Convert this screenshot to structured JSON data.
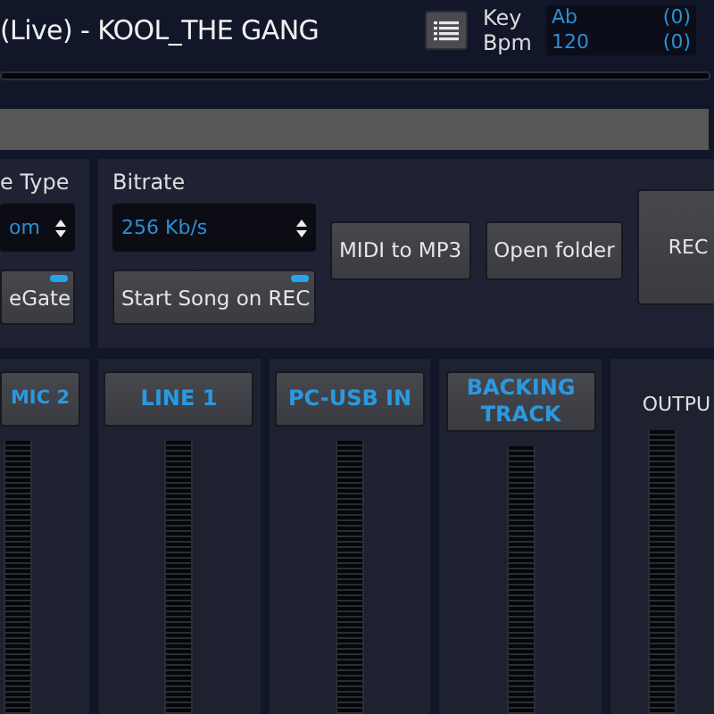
{
  "title": "(Live) - KOOL_THE GANG",
  "key": {
    "label": "Key",
    "value": "Ab",
    "offset": "(0)"
  },
  "bpm": {
    "label": "Bpm",
    "value": "120",
    "offset": "(0)"
  },
  "left_panel": {
    "label": "e Type",
    "select": "om",
    "toggle": {
      "label": "eGate",
      "on": true
    }
  },
  "bitrate": {
    "label": "Bitrate",
    "select": "256 Kb/s",
    "toggle": {
      "label": "Start Song on REC",
      "on": true
    }
  },
  "buttons": [
    "MIDI to MP3",
    "Open folder"
  ],
  "rec_button": "REC",
  "channels": [
    {
      "label": "MIC 2",
      "kind": "input"
    },
    {
      "label": "LINE 1",
      "kind": "input"
    },
    {
      "label": "PC-USB IN",
      "kind": "input"
    },
    {
      "label": "BACKING TRACK",
      "kind": "input"
    },
    {
      "label": "OUTPU",
      "kind": "output"
    }
  ]
}
